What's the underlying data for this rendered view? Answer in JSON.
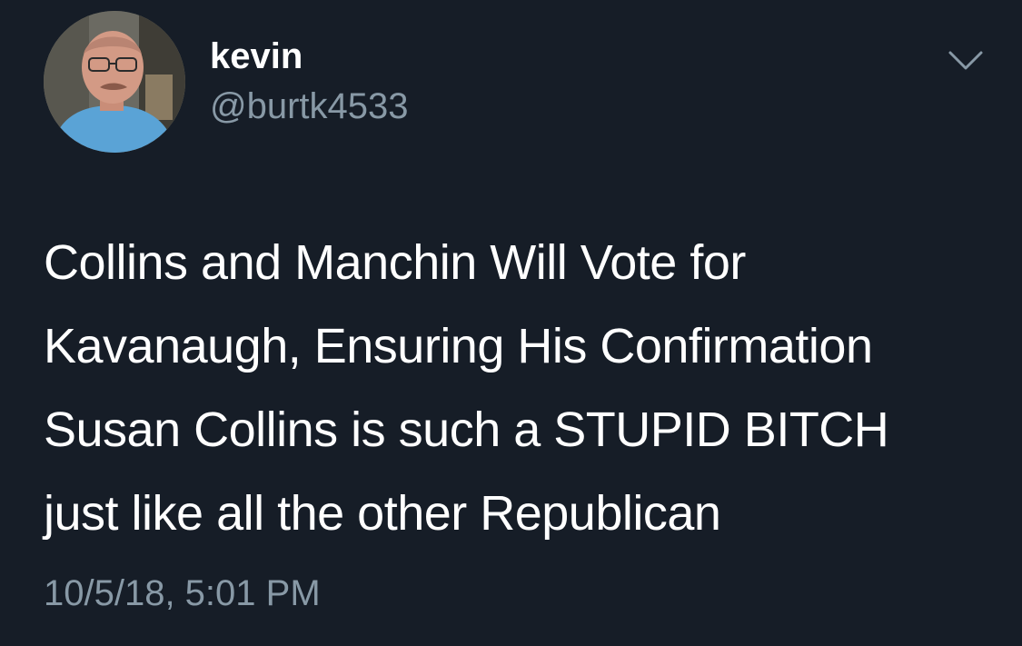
{
  "tweet": {
    "author": {
      "display_name": "kevin",
      "handle": "@burtk4533"
    },
    "text_lines": [
      "Collins and Manchin Will Vote for",
      "Kavanaugh, Ensuring His Confirmation",
      "Susan Collins is such a STUPID BITCH",
      "just like all the other Republican"
    ],
    "timestamp": "10/5/18, 5:01 PM"
  },
  "icons": {
    "menu": "chevron-down-icon",
    "avatar": "user-avatar"
  },
  "colors": {
    "background": "#161d27",
    "primary_text": "#ffffff",
    "secondary_text": "#8899a6"
  }
}
